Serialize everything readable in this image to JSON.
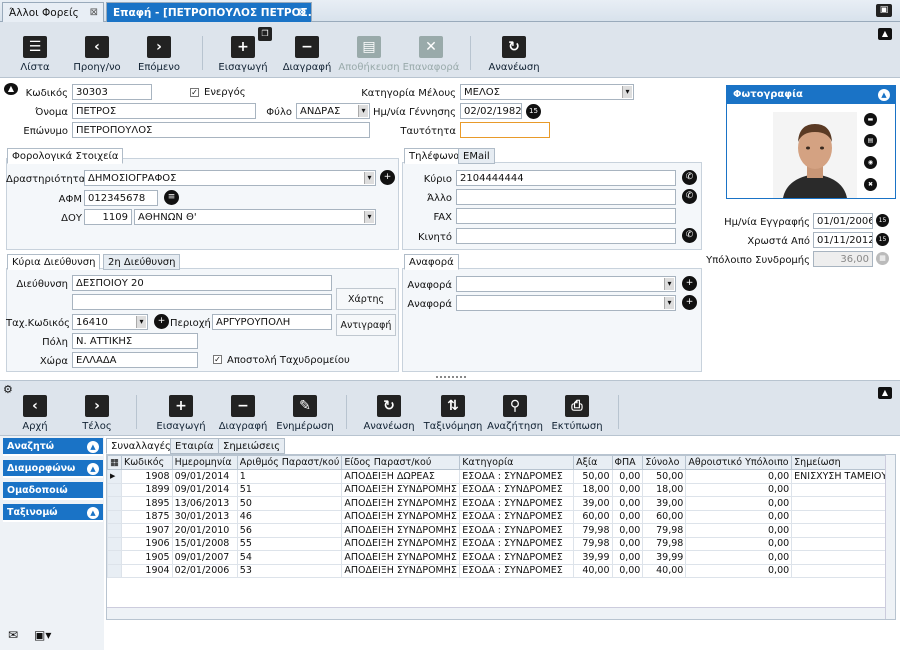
{
  "tabs": [
    {
      "label": "Άλλοι Φορείς"
    },
    {
      "label": "Επαφή - [ΠΕΤΡΟΠΟΥΛΟΣ ΠΕΤΡΟΣ..."
    }
  ],
  "toolbar": {
    "list": "Λίστα",
    "prev": "Προηγ/νο",
    "next": "Επόμενο",
    "insert": "Εισαγωγή",
    "delete": "Διαγραφή",
    "save": "Αποθήκευση",
    "restore": "Επαναφορά",
    "refresh": "Ανανέωση"
  },
  "form": {
    "code_label": "Κωδικός",
    "code": "30303",
    "active_label": "Ενεργός",
    "name_label": "Όνομα",
    "name": "ΠΕΤΡΟΣ",
    "gender_label": "Φύλο",
    "gender": "ΑΝΔΡΑΣ",
    "surname_label": "Επώνυμο",
    "surname": "ΠΕΤΡΟΠΟΥΛΟΣ",
    "category_label": "Κατηγορία Μέλους",
    "category": "ΜΕΛΟΣ",
    "birth_label": "Ημ/νία Γέννησης",
    "birth": "02/02/1982",
    "id_label": "Ταυτότητα",
    "id": ""
  },
  "tax": {
    "tab": "Φορολογικά Στοιχεία",
    "activity_label": "Δραστηριότητα",
    "activity": "ΔΗΜΟΣΙΟΓΡΑΦΟΣ",
    "afm_label": "ΑΦΜ",
    "afm": "012345678",
    "doy_label": "ΔΟΥ",
    "doy_code": "1109",
    "doy_name": "ΑΘΗΝΩΝ Θ'"
  },
  "phones": {
    "tab1": "Τηλέφωνα",
    "tab2": "EMail",
    "main_label": "Κύριο",
    "main": "2104444444",
    "other_label": "Άλλο",
    "fax_label": "FAX",
    "mobile_label": "Κινητό"
  },
  "address": {
    "tab1": "Κύρια Διεύθυνση",
    "tab2": "2η Διεύθυνση",
    "street_label": "Διεύθυνση",
    "street": "ΔΕΣΠΟΙΟΥ 20",
    "map_btn": "Χάρτης",
    "copy_btn": "Αντιγραφή",
    "zip_label": "Ταχ.Κωδικός",
    "zip": "16410",
    "area_label": "Περιοχή",
    "area": "ΑΡΓΥΡΟΥΠΟΛΗ",
    "city_label": "Πόλη",
    "city": "Ν. ΑΤΤΙΚΗΣ",
    "country_label": "Χώρα",
    "country": "ΕΛΛΑΔΑ",
    "mail_label": "Αποστολή Ταχυδρομείου"
  },
  "reference": {
    "tab": "Αναφορά",
    "label1": "Αναφορά",
    "label2": "Αναφορά"
  },
  "photo": {
    "title": "Φωτογραφία"
  },
  "membership": {
    "reg_label": "Ημ/νία Εγγραφής",
    "reg": "01/01/2006",
    "owed_label": "Χρωστά Από",
    "owed": "01/11/2012",
    "balance_label": "Υπόλοιπο Συνδρομής",
    "balance": "36,00"
  },
  "toolbar2": {
    "first": "Αρχή",
    "last": "Τέλος",
    "insert": "Εισαγωγή",
    "delete": "Διαγραφή",
    "update": "Ενημέρωση",
    "refresh": "Ανανέωση",
    "sort": "Ταξινόμηση",
    "search": "Αναζήτηση",
    "print": "Εκτύπωση"
  },
  "sidebar": [
    {
      "label": "Αναζητώ"
    },
    {
      "label": "Διαμορφώνω"
    },
    {
      "label": "Ομαδοποιώ"
    },
    {
      "label": "Ταξινομώ"
    }
  ],
  "subtabs": [
    "Συναλλαγές",
    "Εταιρία",
    "Σημειώσεις"
  ],
  "grid": {
    "columns": [
      "Κωδικός",
      "Ημερομηνία",
      "Αριθμός Παραστ/κού",
      "Είδος Παραστ/κού",
      "Κατηγορία",
      "Αξία",
      "ΦΠΑ",
      "Σύνολο",
      "Αθροιστικό Υπόλοιπο",
      "Σημείωση"
    ],
    "rows": [
      [
        "1908",
        "09/01/2014",
        "1",
        "ΑΠΟΔΕΙΞΗ ΔΩΡΕΑΣ",
        "ΕΣΟΔΑ : ΣΥΝΔΡΟΜΕΣ",
        "50,00",
        "0,00",
        "50,00",
        "0,00",
        "ΕΝΙΣΧΥΣΗ ΤΑΜΕΙΟΥ"
      ],
      [
        "1899",
        "09/01/2014",
        "51",
        "ΑΠΟΔΕΙΞΗ ΣΥΝΔΡΟΜΗΣ",
        "ΕΣΟΔΑ : ΣΥΝΔΡΟΜΕΣ",
        "18,00",
        "0,00",
        "18,00",
        "0,00",
        ""
      ],
      [
        "1895",
        "13/06/2013",
        "50",
        "ΑΠΟΔΕΙΞΗ ΣΥΝΔΡΟΜΗΣ",
        "ΕΣΟΔΑ : ΣΥΝΔΡΟΜΕΣ",
        "39,00",
        "0,00",
        "39,00",
        "0,00",
        ""
      ],
      [
        "1875",
        "30/01/2013",
        "46",
        "ΑΠΟΔΕΙΞΗ ΣΥΝΔΡΟΜΗΣ",
        "ΕΣΟΔΑ : ΣΥΝΔΡΟΜΕΣ",
        "60,00",
        "0,00",
        "60,00",
        "0,00",
        ""
      ],
      [
        "1907",
        "20/01/2010",
        "56",
        "ΑΠΟΔΕΙΞΗ ΣΥΝΔΡΟΜΗΣ",
        "ΕΣΟΔΑ : ΣΥΝΔΡΟΜΕΣ",
        "79,98",
        "0,00",
        "79,98",
        "0,00",
        ""
      ],
      [
        "1906",
        "15/01/2008",
        "55",
        "ΑΠΟΔΕΙΞΗ ΣΥΝΔΡΟΜΗΣ",
        "ΕΣΟΔΑ : ΣΥΝΔΡΟΜΕΣ",
        "79,98",
        "0,00",
        "79,98",
        "0,00",
        ""
      ],
      [
        "1905",
        "09/01/2007",
        "54",
        "ΑΠΟΔΕΙΞΗ ΣΥΝΔΡΟΜΗΣ",
        "ΕΣΟΔΑ : ΣΥΝΔΡΟΜΕΣ",
        "39,99",
        "0,00",
        "39,99",
        "0,00",
        ""
      ],
      [
        "1904",
        "02/01/2006",
        "53",
        "ΑΠΟΔΕΙΞΗ ΣΥΝΔΡΟΜΗΣ",
        "ΕΣΟΔΑ : ΣΥΝΔΡΟΜΕΣ",
        "40,00",
        "0,00",
        "40,00",
        "0,00",
        ""
      ]
    ]
  },
  "colors": {
    "accent": "#1a73c6",
    "toolbar": "#dde4ec",
    "focus": "#e89a2a"
  }
}
